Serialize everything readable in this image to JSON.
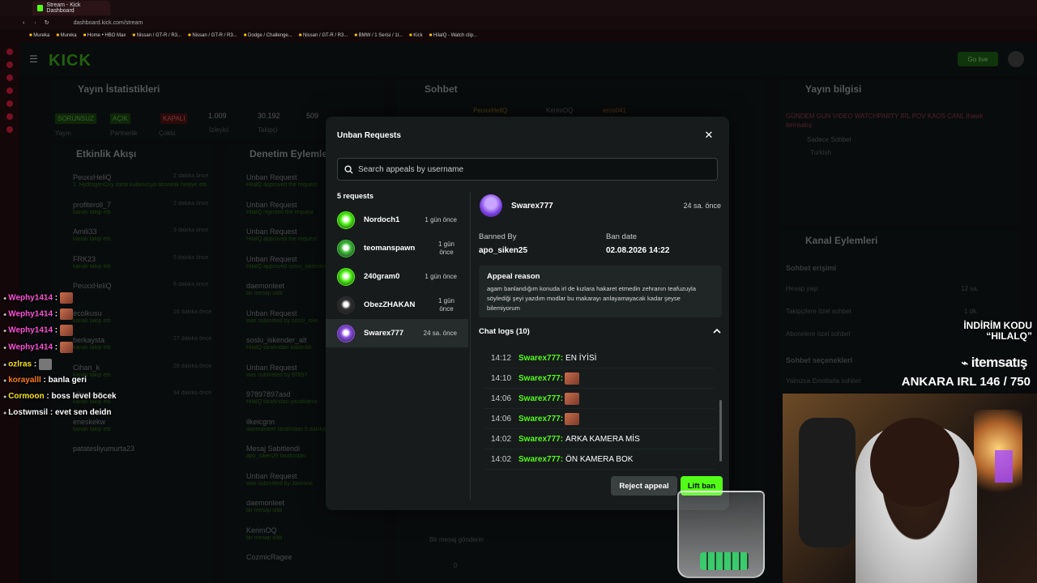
{
  "browser": {
    "tab_title": "Stream - Kick Dashboard",
    "url": "dashboard.kick.com/stream",
    "bookmarks": [
      "Mureka",
      "Mureka",
      "Home • HBO Max",
      "Nissan / GT-R / R3...",
      "Nissan / GT-R / R3...",
      "Dodge / Challenge...",
      "Nissan / GT-R / R3...",
      "BMW / 1 Serisi / 1l...",
      "Kick",
      "HilalQ - Watch clip..."
    ]
  },
  "dashboard": {
    "logo": "KICK",
    "go_live": "Go live",
    "panels": {
      "stats": "Yayın İstatistikleri",
      "chat": "Sohbet",
      "stream_info": "Yayın bilgisi",
      "events": "Etkinlik Akışı",
      "mod_actions": "Denetim Eylemle",
      "channel_actions": "Kanal Eylemleri"
    },
    "stats": {
      "badges": [
        "SORUNSUZ",
        "AÇIK",
        "KAPALI"
      ],
      "numbers": [
        "1.009",
        "30.192",
        "509"
      ],
      "labels": [
        "Yayın",
        "Partnerlik",
        "Çoklu",
        "İzleyici",
        "Takipçi"
      ]
    },
    "chat_users": [
      "PeuxxHeliQ",
      "KerimOQ",
      "eros041"
    ],
    "stream_info": {
      "tags": "GÜNDEM  GUN  VIDEO  WATCHPARTY  IRL  POV  KAOS  CANL  Ihawk  itemsatış",
      "category": "Sadece Sohbet",
      "language": "Turkish"
    },
    "channel_actions": {
      "chat_access": "Sohbet erişimi",
      "rows": [
        "Hesap yaşı",
        "Takipçilere özel sohbet",
        "Abonelere özel sohbet"
      ],
      "row_values": [
        "12 sa.",
        "1 dk."
      ],
      "chat_options": "Sohbet seçenekleri",
      "emote_only": "Yalnızca Emotlarla sohbet"
    },
    "events": [
      {
        "name": "PeuxxHeliQ",
        "time": "2 dakika önce",
        "note": "1. HydrogenOxy isimli kullanıcıya abonelik hediye etti"
      },
      {
        "name": "profiteroll_7",
        "time": "2 dakika önce",
        "note": "kanalı takip etti"
      },
      {
        "name": "Amili33",
        "time": "3 dakika önce",
        "note": "kanalı takip etti"
      },
      {
        "name": "FRK23",
        "time": "5 dakika önce",
        "note": "kanalı takip etti"
      },
      {
        "name": "PeuxxHeliQ",
        "time": "6 dakika önce",
        "note": ""
      },
      {
        "name": "ecolkusu",
        "time": "16 dakika önce",
        "note": "kanalı takip etti"
      },
      {
        "name": "berkaysta",
        "time": "27 dakika önce",
        "note": "kanalı takip etti"
      },
      {
        "name": "Cihan_k",
        "time": "28 dakika önce",
        "note": "kanalı takip etti"
      },
      {
        "name": "vibrason",
        "time": "34 dakika önce",
        "note": "kanalı takip etti"
      },
      {
        "name": "eneskekw",
        "time": "",
        "note": "kanalı takip etti"
      },
      {
        "name": "patatesliyumurta23",
        "time": "",
        "note": ""
      }
    ],
    "mod_actions": [
      {
        "title": "Unban Request",
        "note": "HilalQ approved the request"
      },
      {
        "title": "Unban Request",
        "note": "HilalQ rejected the request"
      },
      {
        "title": "Unban Request",
        "note": "HilalQ approved the request"
      },
      {
        "title": "Unban Request",
        "note": "HilalQ approved sosiu_iskender_alt"
      },
      {
        "title": "daemonleet",
        "note": "bir mesajı sildi"
      },
      {
        "title": "Unban Request",
        "note": "was submitted by sosiu_iske"
      },
      {
        "title": "soslu_iskender_alt",
        "note": "HilalQ tarafından kaldırıldı"
      },
      {
        "title": "Unban Request",
        "note": "was submitted by 97897"
      },
      {
        "title": "97897897asd",
        "note": "HilalQ tarafından yasaklandı"
      },
      {
        "title": "ilkeicgnn",
        "note": "daemonleet tarafından 5 dakika sohbetten uzaklaştırıldı"
      },
      {
        "title": "Mesaj Sabitlendi",
        "note": "apo_siken25 tarafından"
      },
      {
        "title": "Unban Request",
        "note": "was submitted by Jasmine"
      },
      {
        "title": "daemonleet",
        "note": "bir mesajı sildi"
      },
      {
        "title": "KerimOQ",
        "note": "bir mesajı sildi"
      },
      {
        "title": "CozmicRagee",
        "note": ""
      }
    ],
    "chat_input_placeholder": "Bir mesaj gönderin",
    "chat_counter": "0"
  },
  "stream_overlay": {
    "chat": [
      {
        "user": "Wephy1414",
        "text": ""
      },
      {
        "user": "Wephy1414",
        "text": ""
      },
      {
        "user": "Wephy1414",
        "text": ""
      },
      {
        "user": "Wephy1414",
        "text": ""
      },
      {
        "user": "ozlras",
        "text": ""
      },
      {
        "user": "korayalll",
        "text": "banla geri"
      },
      {
        "user": "Cormoon",
        "text": "boss level böcek"
      },
      {
        "user": "Lostwmsil",
        "text": "evet sen deidn"
      }
    ],
    "promo_line1": "İNDİRİM KODU",
    "promo_line2": "“HILALQ”",
    "brand": "itemsatış",
    "goal": "ANKARA IRL 146 / 750"
  },
  "modal": {
    "title": "Unban Requests",
    "search_placeholder": "Search appeals by username",
    "count": "5 requests",
    "requests": [
      {
        "name": "Nordoch1",
        "time": "1 gün önce",
        "color": "#53fc18"
      },
      {
        "name": "teomanspawn",
        "time": "1 gün önce",
        "color": "#3fbf3a"
      },
      {
        "name": "240gram0",
        "time": "1 gün önce",
        "color": "#53fc18"
      },
      {
        "name": "ObezZHAKAN",
        "time": "1 gün önce",
        "color": "#2e2e2e"
      },
      {
        "name": "Swarex777",
        "time": "24 sa. önce",
        "color": "#8b4fe6"
      }
    ],
    "selected_index": 4,
    "detail": {
      "name": "Swarex777",
      "time": "24 sa. önce",
      "banned_by_label": "Banned By",
      "banned_by": "apo_siken25",
      "ban_date_label": "Ban date",
      "ban_date": "02.08.2026 14:22",
      "appeal_label": "Appeal reason",
      "appeal_text": "agam banlandığım konuda irl de kızlara hakaret etmedin zehranın teafuzuyla söylediği şeyi yazdım modlar bu makarayı anlayamayacak kadar şeyse bilemiyorum",
      "chat_logs_label": "Chat logs (10)"
    },
    "logs": [
      {
        "time": "14:12",
        "user": "Swarex777:",
        "text": "EN İYİSİ",
        "emote": false
      },
      {
        "time": "14:10",
        "user": "Swarex777:",
        "text": "",
        "emote": true
      },
      {
        "time": "14:06",
        "user": "Swarex777:",
        "text": "",
        "emote": true
      },
      {
        "time": "14:06",
        "user": "Swarex777:",
        "text": "",
        "emote": true
      },
      {
        "time": "14:02",
        "user": "Swarex777:",
        "text": "ARKA KAMERA MİS",
        "emote": false
      },
      {
        "time": "14:02",
        "user": "Swarex777:",
        "text": "ÖN KAMERA BOK",
        "emote": false
      }
    ],
    "reject_label": "Reject appeal",
    "lift_label": "Lift ban"
  }
}
